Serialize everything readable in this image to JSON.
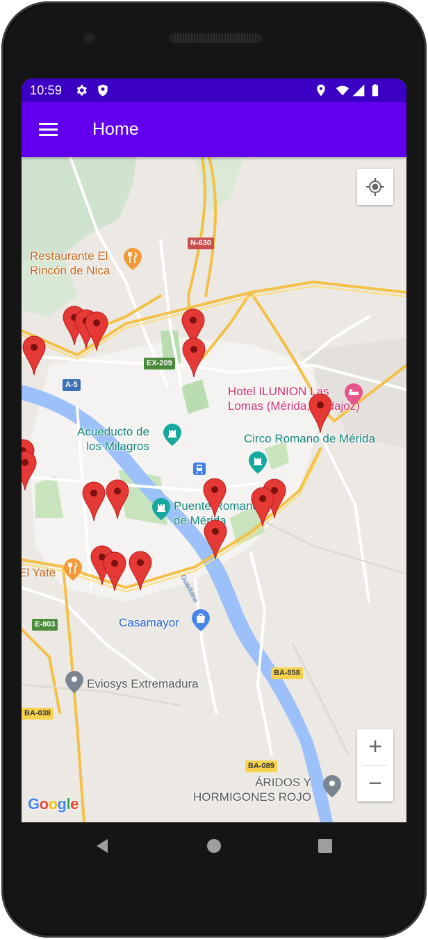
{
  "status_bar": {
    "time": "10:59",
    "left_icons": [
      "gear-icon",
      "shield-icon"
    ],
    "right_icons": [
      "location-icon",
      "wifi-icon",
      "signal-icon",
      "battery-icon"
    ]
  },
  "app_bar": {
    "title": "Home",
    "menu_icon": "hamburger-menu-icon",
    "color": "#6200ee",
    "status_color": "#3b00c4"
  },
  "map": {
    "places": [
      {
        "name": "Restaurante El\nRincón de Nica",
        "type": "restaurant"
      },
      {
        "name": "Hotel ILUNION Las\nLomas (Mérida, Badajoz)",
        "type": "hotel"
      },
      {
        "name": "Acueducto de\nlos Milagros",
        "type": "landmark"
      },
      {
        "name": "Circo Romano de Mérida",
        "type": "landmark"
      },
      {
        "name": "Puente Romano\nde Mérida",
        "type": "landmark"
      },
      {
        "name": "El Yate",
        "type": "restaurant"
      },
      {
        "name": "Casamayor",
        "type": "shopping"
      },
      {
        "name": "Eviosys Extremadura",
        "type": "place"
      },
      {
        "name": "ÁRIDOS Y\nHORMIGONES ROJO",
        "type": "place"
      }
    ],
    "roads": [
      "N-630",
      "EX-209",
      "A-5",
      "E-803",
      "BA-058",
      "BA-038",
      "BA-089"
    ],
    "river": "Guadiana",
    "marker_count": 20,
    "marker_color": "#e53935",
    "attribution": "Google"
  },
  "controls": {
    "my_location_icon": "my-location-icon",
    "zoom_in": "+",
    "zoom_out": "−"
  },
  "nav_bar": {
    "back_icon": "back-triangle-icon",
    "home_icon": "home-circle-icon",
    "recents_icon": "recents-square-icon"
  }
}
